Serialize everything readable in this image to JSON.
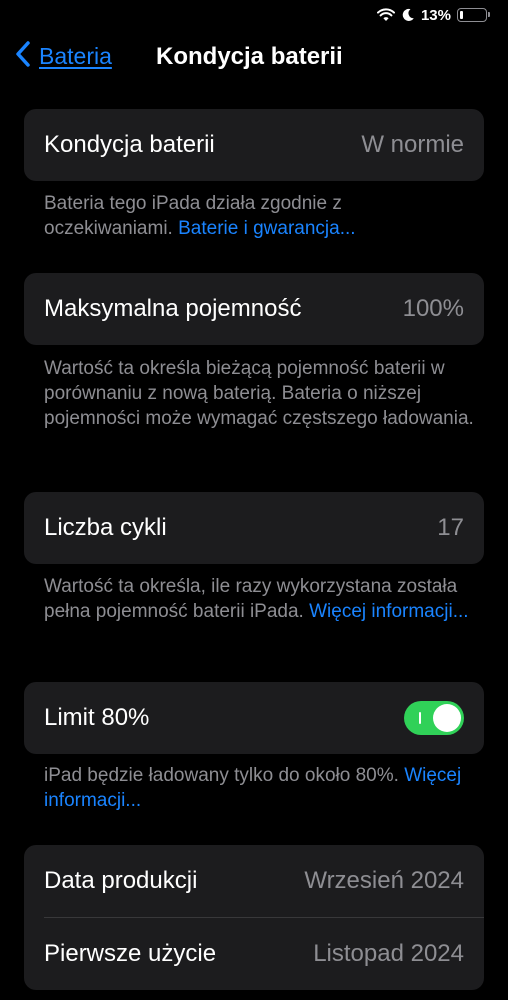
{
  "status_bar": {
    "battery_percent": "13%",
    "battery_level": 0.13
  },
  "nav": {
    "back_label": "Bateria",
    "title": "Kondycja baterii"
  },
  "health": {
    "label": "Kondycja baterii",
    "value": "W normie",
    "footer_text": "Bateria tego iPada działa zgodnie z oczekiwaniami. ",
    "footer_link": "Baterie i gwarancja..."
  },
  "capacity": {
    "label": "Maksymalna pojemność",
    "value": "100%",
    "footer_text": "Wartość ta określa bieżącą pojemność baterii w porównaniu z nową baterią. Bateria o niższej pojemności może wymagać częstszego ładowania."
  },
  "cycles": {
    "label": "Liczba cykli",
    "value": "17",
    "footer_text": "Wartość ta określa, ile razy wykorzystana została pełna pojemność baterii iPada. ",
    "footer_link": "Więcej informacji..."
  },
  "limit": {
    "label": "Limit 80%",
    "toggle_on": true,
    "footer_text": "iPad będzie ładowany tylko do około 80%. ",
    "footer_link": "Więcej informacji..."
  },
  "dates": {
    "production_label": "Data produkcji",
    "production_value": "Wrzesień 2024",
    "first_use_label": "Pierwsze użycie",
    "first_use_value": "Listopad 2024"
  },
  "colors": {
    "accent": "#1a84ff",
    "toggle_on": "#30d158",
    "cell_bg": "#1c1c1e",
    "secondary_text": "#8e8e93"
  },
  "icons": [
    "wifi-icon",
    "moon-icon",
    "battery-icon",
    "chevron-left-icon"
  ]
}
